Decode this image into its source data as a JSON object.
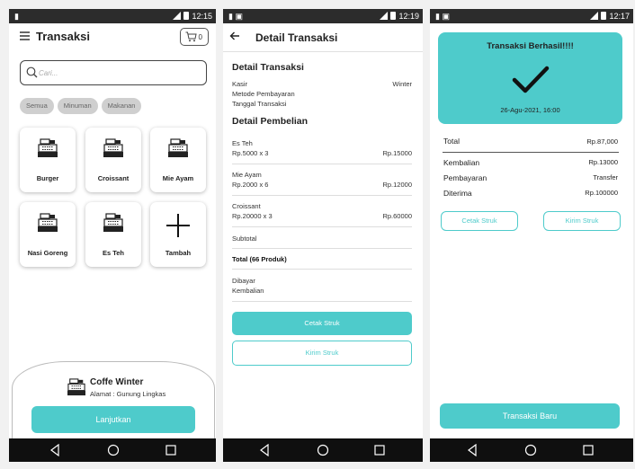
{
  "screen1": {
    "status_time": "12:15",
    "title": "Transaksi",
    "cart_count": "0",
    "search_placeholder": "Cari...",
    "chips": [
      "Semua",
      "Minuman",
      "Makanan"
    ],
    "products": [
      "Burger",
      "Croissant",
      "Mie Ayam",
      "Nasi Goreng",
      "Es Teh",
      "Tambah"
    ],
    "store_name": "Coffe Winter",
    "store_address": "Alamat : Gunung Lingkas",
    "continue_label": "Lanjutkan"
  },
  "screen2": {
    "status_time": "12:19",
    "title": "Detail Transaksi",
    "section_transaction": "Detail Transaksi",
    "cashier_label": "Kasir",
    "cashier_value": "Winter",
    "payment_method_label": "Metode Pembayaran",
    "date_label": "Tanggal Transaksi",
    "section_purchase": "Detail Pembelian",
    "items": [
      {
        "name": "Es Teh",
        "qty_price": "Rp.5000 x 3",
        "total": "Rp.15000"
      },
      {
        "name": "Mie Ayam",
        "qty_price": "Rp.2000 x 6",
        "total": "Rp.12000"
      },
      {
        "name": "Croissant",
        "qty_price": "Rp.20000 x 3",
        "total": "Rp.60000"
      }
    ],
    "subtotal_label": "Subtotal",
    "total_label": "Total (66 Produk)",
    "paid_label": "Dibayar",
    "change_label": "Kembalian",
    "print_label": "Cetak Struk",
    "send_label": "Kirim Struk"
  },
  "screen3": {
    "status_time": "12:17",
    "success_title": "Transaksi Berhasil!!!!",
    "success_date": "26-Agu-2021, 16:00",
    "total_label": "Total",
    "total_value": "Rp.87,000",
    "change_label": "Kembalian",
    "change_value": "Rp.13000",
    "payment_label": "Pembayaran",
    "payment_value": "Transfer",
    "received_label": "Diterima",
    "received_value": "Rp.100000",
    "print_label": "Cetak Struk",
    "send_label": "Kirim Struk",
    "new_transaction_label": "Transaksi Baru"
  },
  "colors": {
    "accent": "#4ecbcb",
    "status_bar": "#2c2c2c",
    "nav_bar": "#0f0f0f"
  },
  "icons": [
    "menu-icon",
    "cart-icon",
    "search-icon",
    "cash-register-icon",
    "plus-icon",
    "back-arrow-icon",
    "checkmark-icon",
    "nav-back-icon",
    "nav-home-icon",
    "nav-recents-icon"
  ]
}
